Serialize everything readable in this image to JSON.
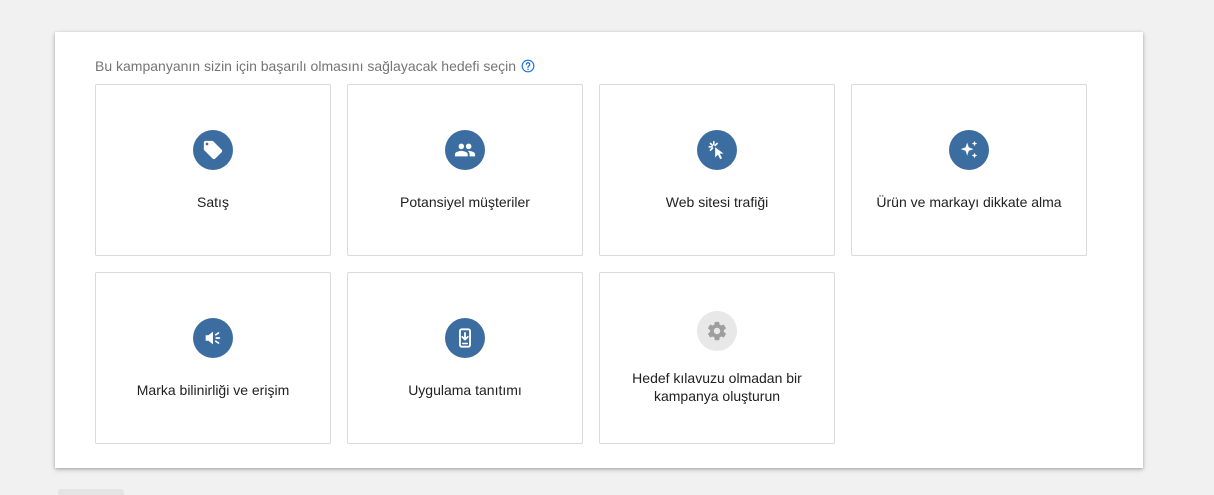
{
  "prompt": {
    "text": "Bu kampanyanın sizin için başarılı olmasını sağlayacak hedefi seçin",
    "help_icon": "help-circle-icon"
  },
  "goals": [
    {
      "label": "Satış",
      "icon": "tag-icon"
    },
    {
      "label": "Potansiyel müşteriler",
      "icon": "people-icon"
    },
    {
      "label": "Web sitesi trafiği",
      "icon": "cursor-click-icon"
    },
    {
      "label": "Ürün ve markayı dikkate alma",
      "icon": "sparkle-icon"
    },
    {
      "label": "Marka bilinirliği ve erişim",
      "icon": "megaphone-icon"
    },
    {
      "label": "Uygulama tanıtımı",
      "icon": "phone-download-icon"
    },
    {
      "label": "Hedef kılavuzu olmadan bir kampanya oluşturun",
      "icon": "gear-icon"
    }
  ],
  "colors": {
    "accent": "#3c6da0",
    "help_icon": "#1a73e8",
    "neutral_icon_bg": "#e8e8e8",
    "neutral_icon": "#9e9e9e"
  }
}
